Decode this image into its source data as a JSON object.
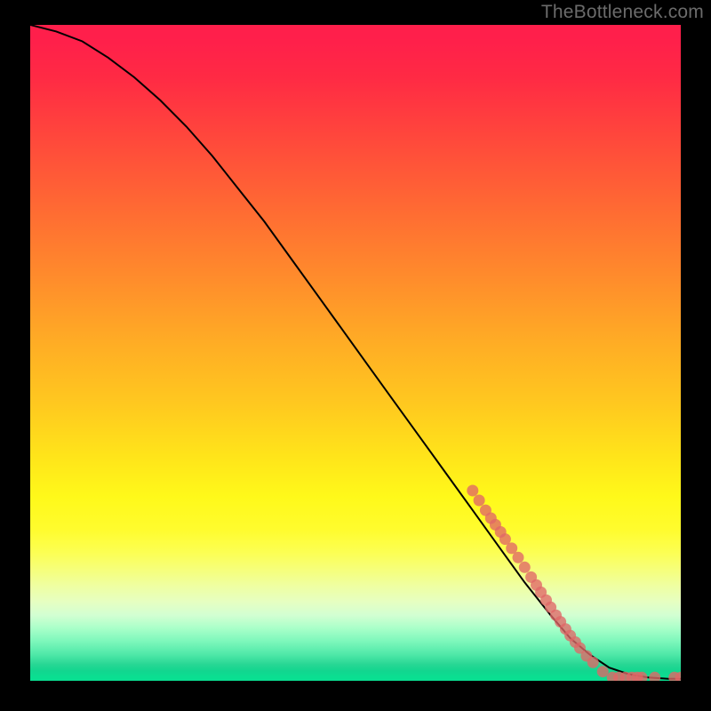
{
  "watermark": "TheBottleneck.com",
  "colors": {
    "background": "#000000",
    "curve": "#000000",
    "dot": "#e06666",
    "gradient_top": "#ff1f4b",
    "gradient_bottom": "#0adf91"
  },
  "chart_data": {
    "type": "line",
    "title": "",
    "xlabel": "",
    "ylabel": "",
    "xlim": [
      0,
      100
    ],
    "ylim": [
      0,
      100
    ],
    "curve": {
      "name": "bottleneck-curve",
      "x": [
        0,
        4,
        8,
        12,
        16,
        20,
        24,
        28,
        32,
        36,
        40,
        44,
        48,
        52,
        56,
        60,
        64,
        68,
        72,
        76,
        80,
        83,
        86,
        89,
        92,
        95,
        98,
        100
      ],
      "y": [
        100,
        99,
        97.5,
        95,
        92,
        88.5,
        84.5,
        80,
        75,
        70,
        64.5,
        59,
        53.5,
        48,
        42.5,
        37,
        31.5,
        26,
        20.5,
        15,
        10,
        6.5,
        4,
        2,
        1,
        0.5,
        0.3,
        0.3
      ]
    },
    "series": [
      {
        "name": "data-points",
        "type": "scatter",
        "points": [
          {
            "x": 68,
            "y": 29
          },
          {
            "x": 69,
            "y": 27.5
          },
          {
            "x": 70,
            "y": 26
          },
          {
            "x": 70.8,
            "y": 24.8
          },
          {
            "x": 71.5,
            "y": 23.8
          },
          {
            "x": 72.3,
            "y": 22.7
          },
          {
            "x": 73,
            "y": 21.6
          },
          {
            "x": 74,
            "y": 20.2
          },
          {
            "x": 75,
            "y": 18.8
          },
          {
            "x": 76,
            "y": 17.3
          },
          {
            "x": 77,
            "y": 15.8
          },
          {
            "x": 77.8,
            "y": 14.6
          },
          {
            "x": 78.5,
            "y": 13.5
          },
          {
            "x": 79.3,
            "y": 12.3
          },
          {
            "x": 80,
            "y": 11.2
          },
          {
            "x": 80.8,
            "y": 10.0
          },
          {
            "x": 81.5,
            "y": 9.0
          },
          {
            "x": 82.3,
            "y": 7.9
          },
          {
            "x": 83,
            "y": 6.9
          },
          {
            "x": 83.8,
            "y": 5.9
          },
          {
            "x": 84.5,
            "y": 5.0
          },
          {
            "x": 85.5,
            "y": 3.8
          },
          {
            "x": 86.5,
            "y": 2.8
          },
          {
            "x": 88,
            "y": 1.4
          },
          {
            "x": 89.5,
            "y": 0.5
          },
          {
            "x": 90.5,
            "y": 0.5
          },
          {
            "x": 91.5,
            "y": 0.5
          },
          {
            "x": 92.5,
            "y": 0.5
          },
          {
            "x": 93.3,
            "y": 0.5
          },
          {
            "x": 94,
            "y": 0.5
          },
          {
            "x": 96,
            "y": 0.5
          },
          {
            "x": 99,
            "y": 0.5
          },
          {
            "x": 100,
            "y": 0.5
          }
        ]
      }
    ]
  }
}
